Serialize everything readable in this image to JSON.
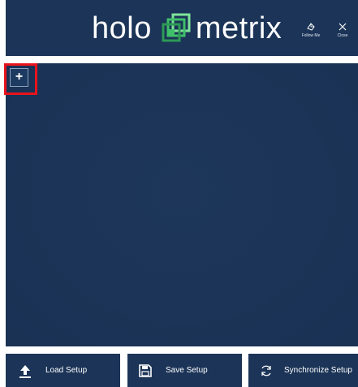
{
  "header": {
    "brand_left": "holo",
    "brand_right": "metrix",
    "follow_label": "Follow Me",
    "close_label": "Close"
  },
  "main": {
    "add_label": "+"
  },
  "footer": {
    "load_label": "Load Setup",
    "save_label": "Save Setup",
    "sync_label": "Synchronize Setup"
  },
  "icons": {
    "follow": "follow-me-icon",
    "close": "close-icon",
    "load": "upload-icon",
    "save": "save-icon",
    "sync": "sync-icon",
    "logo": "holometrix-logo"
  },
  "colors": {
    "panel": "#1b3457",
    "highlight": "#e8141c",
    "logo_green": "#3fbf6a",
    "text": "#ffffff"
  }
}
